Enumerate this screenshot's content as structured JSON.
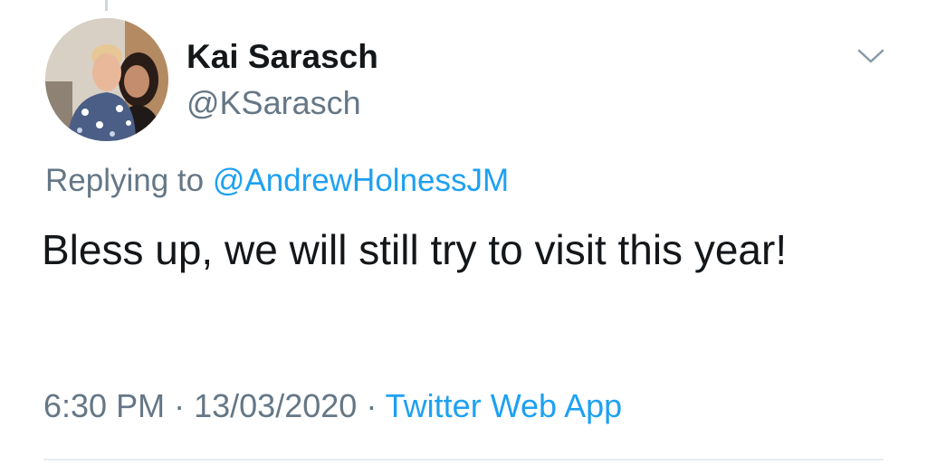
{
  "tweet": {
    "display_name": "Kai Sarasch",
    "handle": "@KSarasch",
    "avatar_icon": "profile-photo-two-people",
    "more_icon": "chevron-down-icon",
    "replying_prefix": "Replying to",
    "replying_mention": "@AndrewHolnessJM",
    "text": "Bless up, we will still try to visit this year!",
    "time": "6:30 PM",
    "date": "13/03/2020",
    "separator": "·",
    "source": "Twitter Web App"
  },
  "colors": {
    "text": "#14171a",
    "secondary": "#657786",
    "link": "#1da1f2",
    "divider": "#e6ecf0"
  }
}
